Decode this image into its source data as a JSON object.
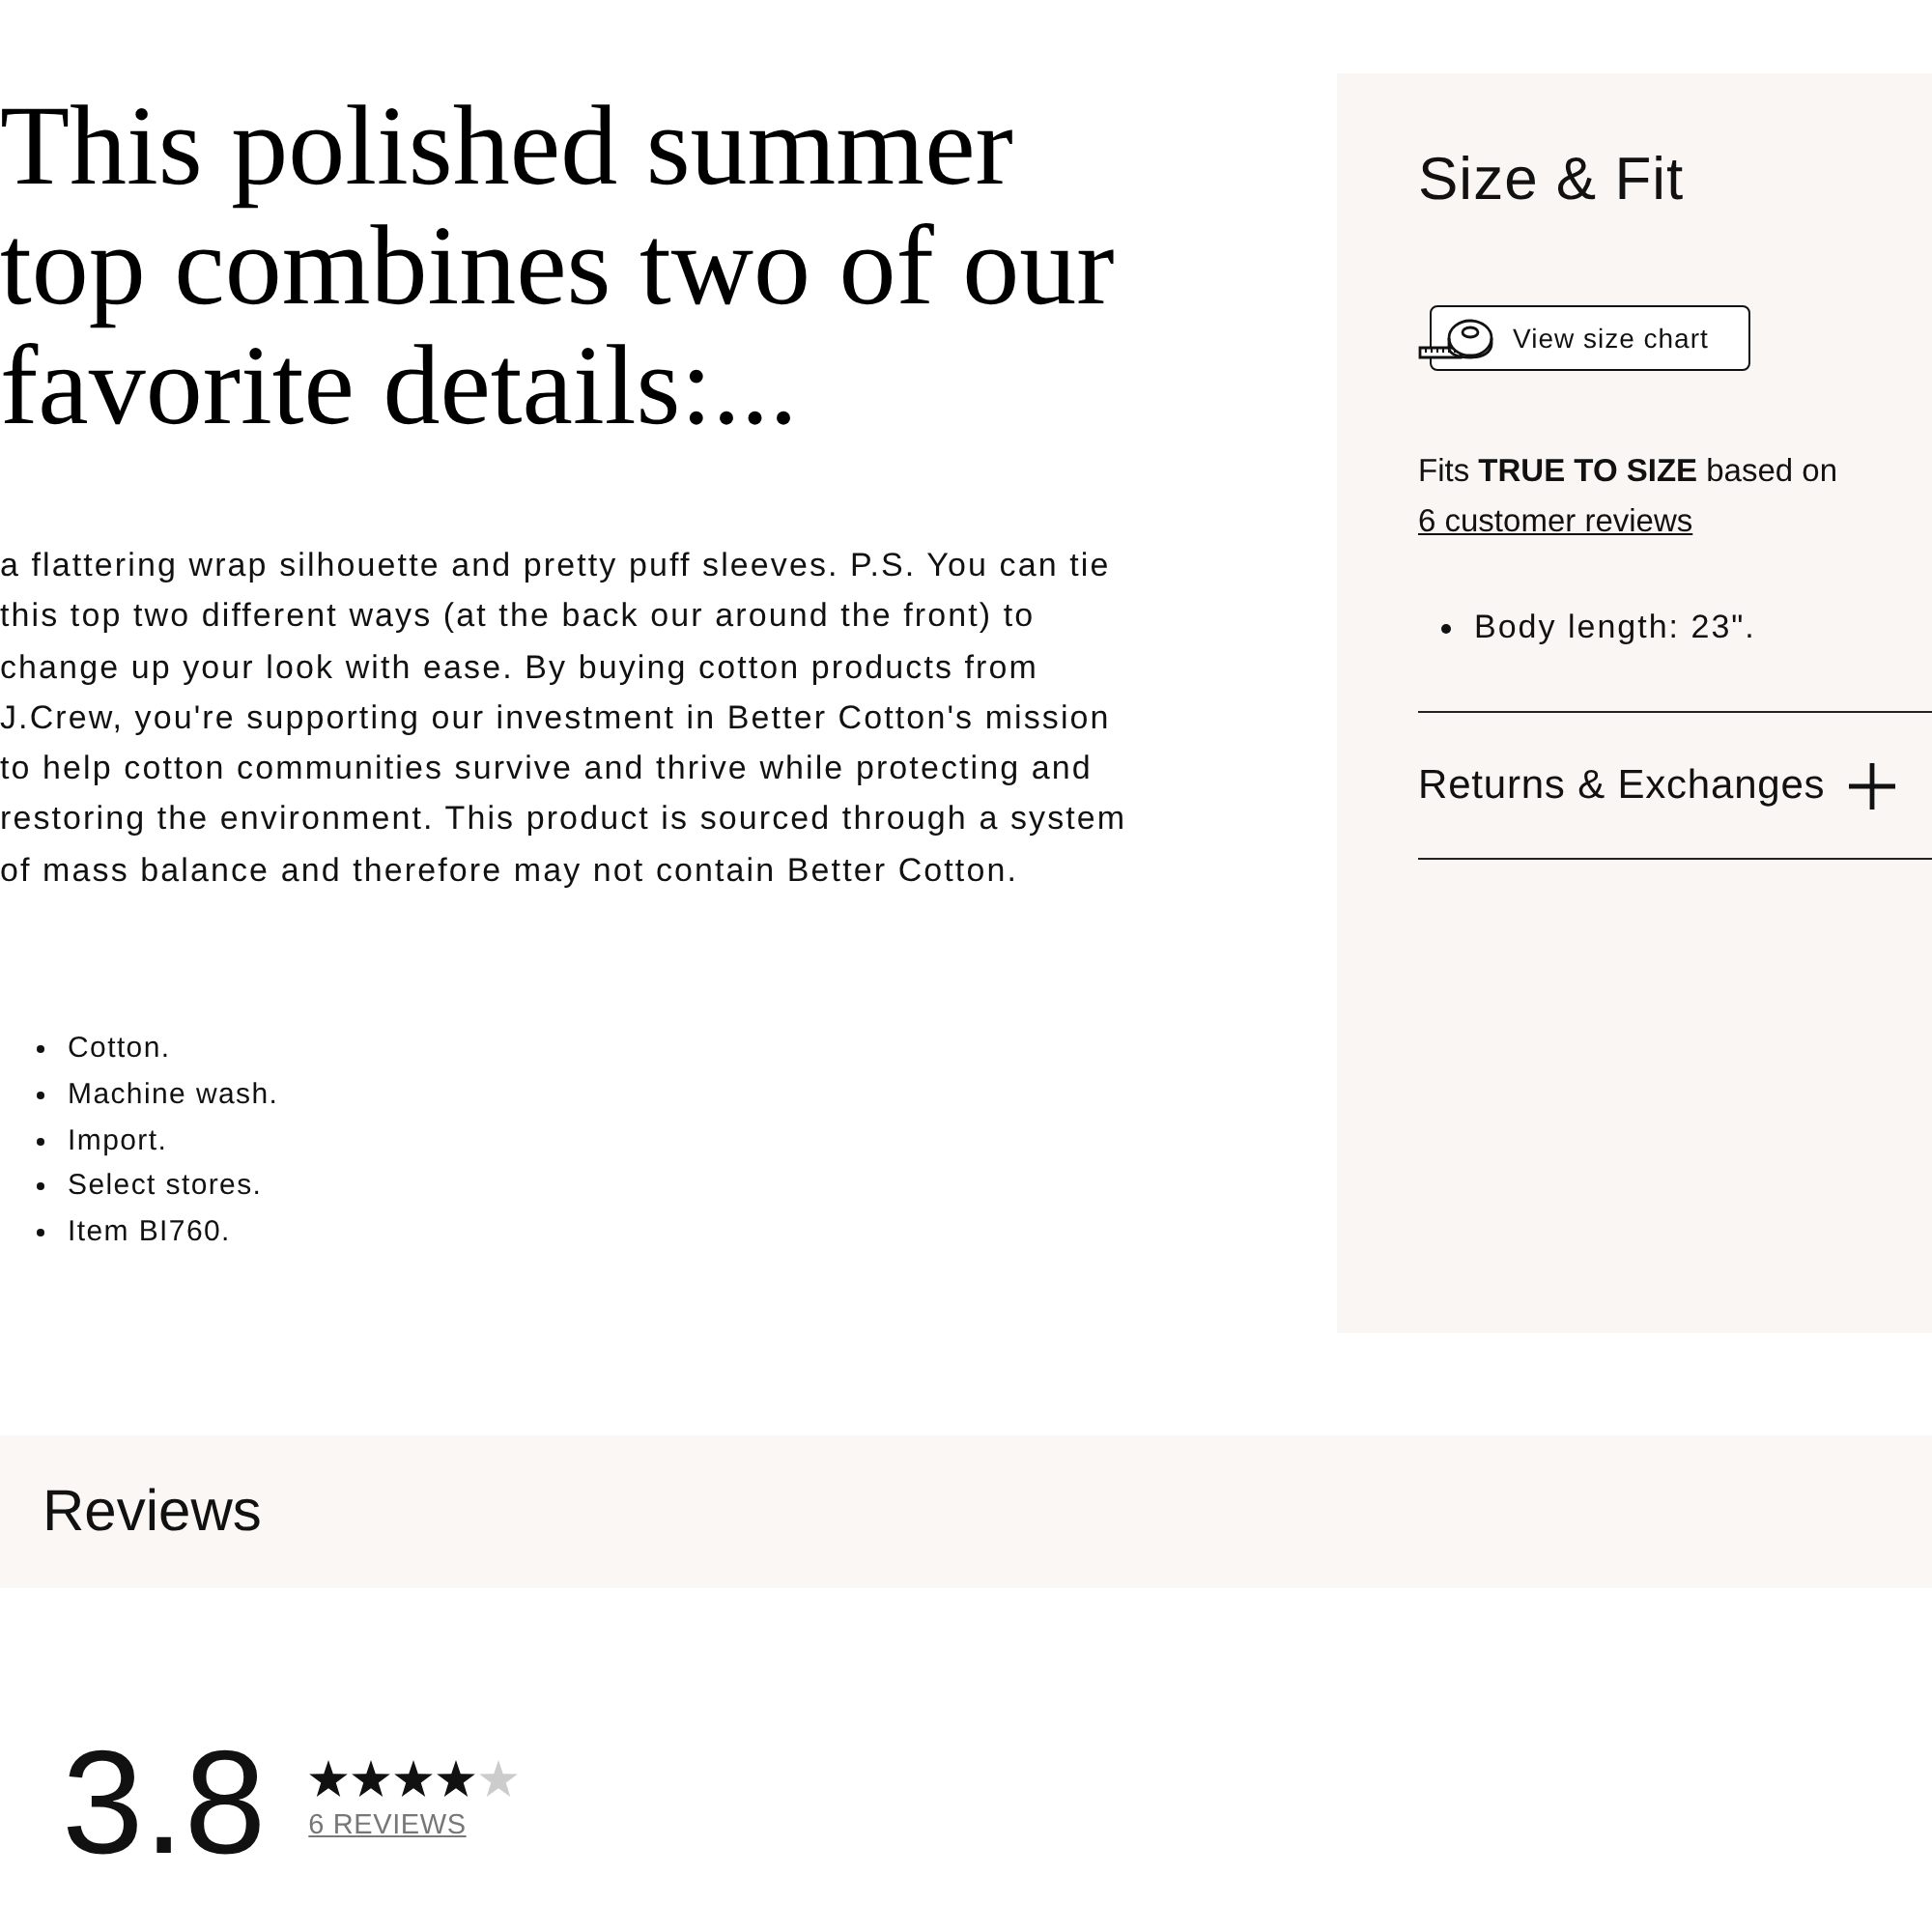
{
  "description": {
    "headline": "This polished summer top combines two of our favorite details:...",
    "body": "a flattering wrap silhouette and pretty puff sleeves. P.S. You can tie this top two different ways (at the back our around the front) to change up your look with ease. By buying cotton products from J.Crew, you're supporting our investment in Better Cotton's mission to help cotton communities survive and thrive while protecting and restoring the environment. This product is sourced through a system of mass balance and therefore may not contain Better Cotton.",
    "features": [
      "Cotton.",
      "Machine wash.",
      "Import.",
      "Select stores.",
      "Item BI760."
    ]
  },
  "size_fit": {
    "title": "Size & Fit",
    "size_chart_button": "View size chart",
    "fit_summary": "Fits **TRUE TO SIZE** based on",
    "fit_reviews_link": "6 customer reviews",
    "measurements": [
      "Body length: 23\"."
    ],
    "accordions": [
      {
        "label": "Returns & Exchanges",
        "expanded": false
      }
    ]
  },
  "reviews": {
    "title": "Reviews",
    "average": "3.8",
    "stars": 4,
    "count_link": "6 REVIEWS"
  }
}
